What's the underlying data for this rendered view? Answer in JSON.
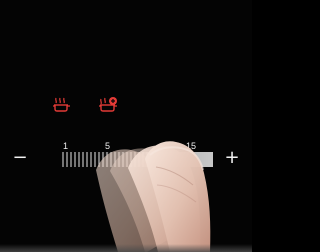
{
  "icons": {
    "mode_one": "steam-pot-icon",
    "mode_two": "boil-plus-pot-icon",
    "icon_color": "#e43b37"
  },
  "controls": {
    "minus_label": "−",
    "plus_label": "+"
  },
  "slider": {
    "min": 1,
    "mid": 5,
    "max": 15,
    "labels": [
      "1",
      "5",
      "15"
    ],
    "fill_color": "#c8c8c8",
    "tick_color": "#e6e6e6",
    "active_segments_from": 5
  }
}
